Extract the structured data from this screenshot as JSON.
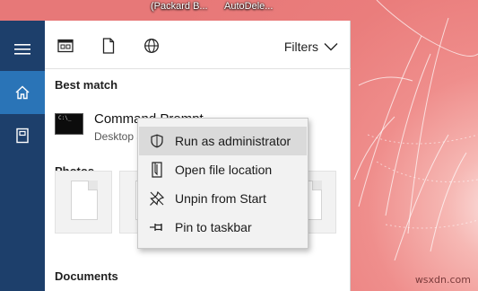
{
  "desktop": {
    "labels": [
      "(Packard B...",
      "AutoDele..."
    ],
    "watermark": "wsxdn.com"
  },
  "rail": {
    "icons": [
      "hamburger-menu-icon",
      "home-icon",
      "notebook-icon"
    ],
    "active": "home"
  },
  "toolbar": {
    "icons": [
      "apps-filter-icon",
      "documents-filter-icon",
      "web-filter-icon"
    ],
    "filters_label": "Filters"
  },
  "results": {
    "best_match_title": "Best match",
    "best_match": {
      "name": "Command Prompt",
      "subtitle": "Desktop app"
    },
    "photos_title": "Photos",
    "documents_title": "Documents"
  },
  "context_menu": {
    "items": [
      {
        "label": "Run as administrator",
        "icon": "shield-icon",
        "highlighted": true
      },
      {
        "label": "Open file location",
        "icon": "file-location-icon",
        "highlighted": false
      },
      {
        "label": "Unpin from Start",
        "icon": "unpin-icon",
        "highlighted": false
      },
      {
        "label": "Pin to taskbar",
        "icon": "pin-icon",
        "highlighted": false
      }
    ]
  },
  "colors": {
    "rail": "#1d3f6b",
    "rail_active": "#2a74b7",
    "menu_bg": "#f2f2f2",
    "menu_highlight": "#dadada"
  }
}
